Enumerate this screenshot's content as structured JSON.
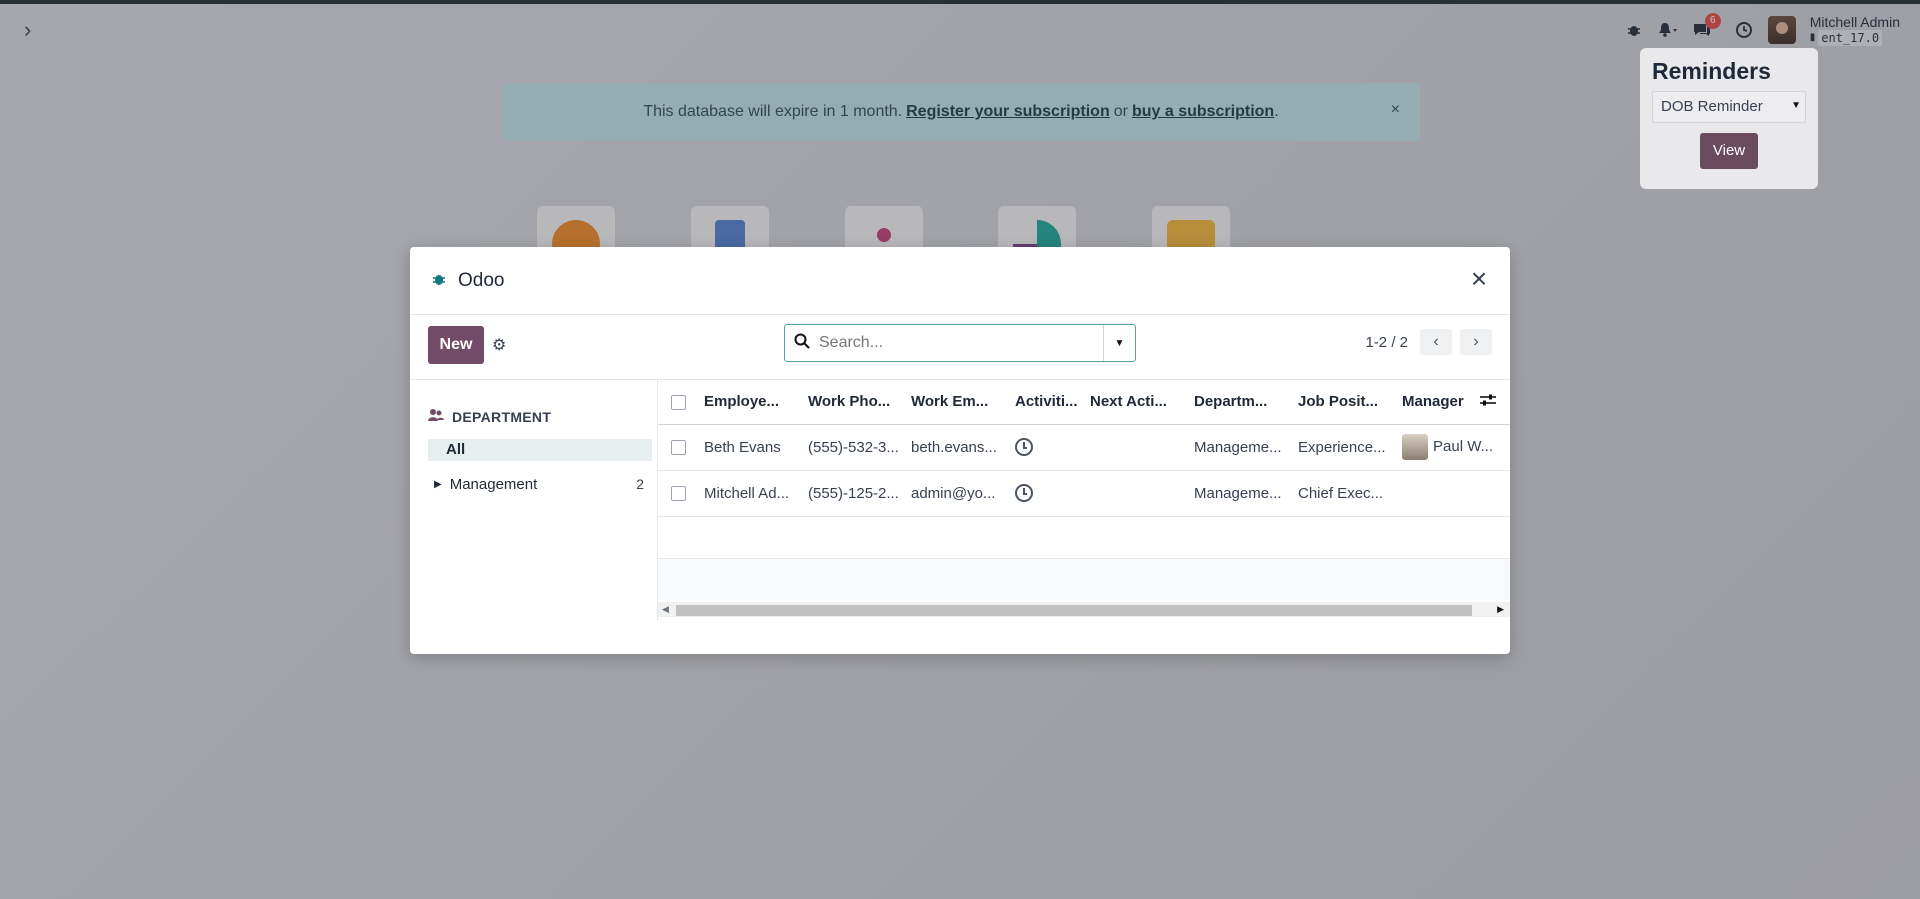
{
  "navbar": {
    "user_name": "Mitchell Admin",
    "database": "ent_17.0",
    "messages_count": "6"
  },
  "banner": {
    "text_prefix": "This database will expire in 1 month.",
    "register_link": "Register your subscription",
    "or_text": "or",
    "buy_link": "buy a subscription",
    "suffix": ".",
    "close": "×"
  },
  "reminders": {
    "title": "Reminders",
    "selected": "DOB Reminder",
    "view_label": "View"
  },
  "modal": {
    "title": "Odoo",
    "close": "×",
    "new_label": "New",
    "search_placeholder": "Search...",
    "pager_value": "1-2 / 2",
    "sidebar": {
      "heading": "DEPARTMENT",
      "all_label": "All",
      "items": [
        {
          "label": "Management",
          "count": "2"
        }
      ]
    },
    "columns": [
      "Employe...",
      "Work Pho...",
      "Work Em...",
      "Activiti...",
      "Next Acti...",
      "Departm...",
      "Job Posit...",
      "Manager"
    ],
    "rows": [
      {
        "name": "Beth Evans",
        "phone": "(555)-532-3...",
        "email": "beth.evans...",
        "next_activity": "",
        "department": "Manageme...",
        "job": "Experience...",
        "manager": "Paul W..."
      },
      {
        "name": "Mitchell Ad...",
        "phone": "(555)-125-2...",
        "email": "admin@yo...",
        "next_activity": "",
        "department": "Manageme...",
        "job": "Chief Exec...",
        "manager": ""
      }
    ]
  },
  "colors": {
    "primary": "#714b67",
    "banner_bg": "#bfe4e6",
    "search_border": "#5aa1a6"
  }
}
